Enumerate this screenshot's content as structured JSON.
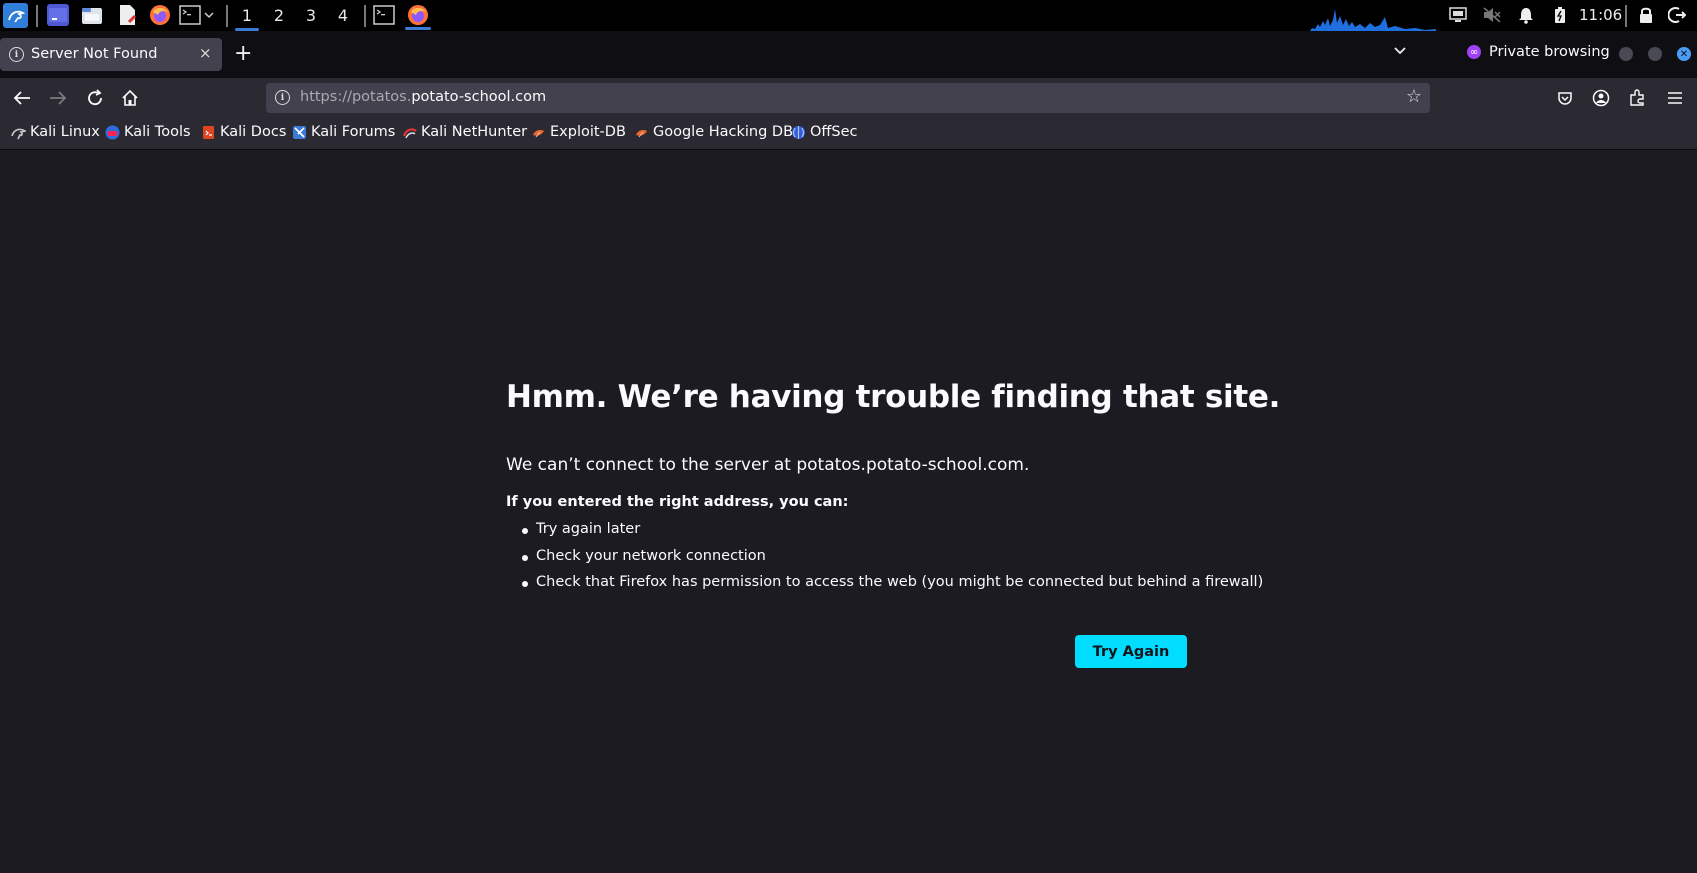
{
  "taskbar": {
    "workspaces": [
      "1",
      "2",
      "3",
      "4"
    ],
    "clock": "11:06"
  },
  "tab": {
    "title": "Server Not Found",
    "new_tab": "+",
    "close": "×"
  },
  "window": {
    "private_label": "Private browsing"
  },
  "navbar": {
    "url_prefix": "https://potatos.",
    "url_domain": "potato-school.com"
  },
  "bookmarks": [
    {
      "label": "Kali Linux",
      "icon": "kali-dragon-icon"
    },
    {
      "label": "Kali Tools",
      "icon": "kali-tools-icon"
    },
    {
      "label": "Kali Docs",
      "icon": "kali-docs-icon"
    },
    {
      "label": "Kali Forums",
      "icon": "kali-forums-icon"
    },
    {
      "label": "Kali NetHunter",
      "icon": "nethunter-icon"
    },
    {
      "label": "Exploit-DB",
      "icon": "exploit-db-icon"
    },
    {
      "label": "Google Hacking DB",
      "icon": "ghdb-icon"
    },
    {
      "label": "OffSec",
      "icon": "offsec-icon"
    }
  ],
  "error": {
    "title": "Hmm. We’re having trouble finding that site.",
    "description": "We can’t connect to the server at potatos.potato-school.com.",
    "subtitle": "If you entered the right address, you can:",
    "suggestions": [
      "Try again later",
      "Check your network connection",
      "Check that Firefox has permission to access the web (you might be connected but behind a firewall)"
    ],
    "button_label": "Try Again"
  },
  "colors": {
    "accent": "#00ddff",
    "page_bg": "#1c1b22",
    "toolbar_bg": "#2b2a33",
    "tab_active": "#42414d",
    "taskbar_active": "#3a7bd5"
  }
}
